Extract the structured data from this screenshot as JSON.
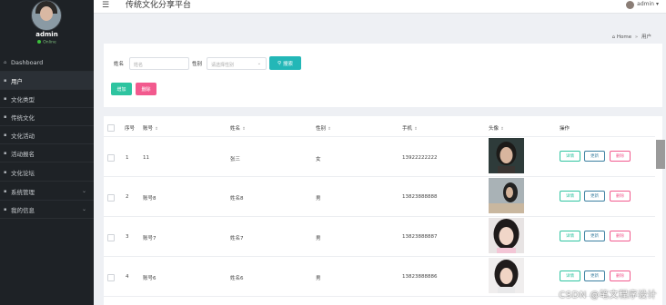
{
  "sidebar": {
    "username": "admin",
    "status": "Online",
    "items": [
      {
        "icon": "home-icon",
        "glyph": "⌂",
        "label": "Dashboard"
      },
      {
        "icon": "grid-icon",
        "glyph": "▪",
        "label": "用户"
      },
      {
        "icon": "grid-icon",
        "glyph": "▪",
        "label": "文化类型"
      },
      {
        "icon": "book-icon",
        "glyph": "▪",
        "label": "传统文化"
      },
      {
        "icon": "list-icon",
        "glyph": "▪",
        "label": "文化活动"
      },
      {
        "icon": "list-icon",
        "glyph": "▪",
        "label": "活动报名"
      },
      {
        "icon": "pin-icon",
        "glyph": "▪",
        "label": "文化论坛"
      },
      {
        "icon": "grid-icon",
        "glyph": "▪",
        "label": "系统管理",
        "chevron": "⌄"
      },
      {
        "icon": "grid-icon",
        "glyph": "▪",
        "label": "我的信息",
        "chevron": "⌄"
      }
    ]
  },
  "header": {
    "title": "传统文化分享平台",
    "user": "admin",
    "user_caret": "▾",
    "menu_glyph": "☰"
  },
  "breadcrumb": {
    "home": "Home",
    "sep": "»",
    "current": "用户",
    "home_glyph": "⌂"
  },
  "search": {
    "name_label": "姓名",
    "name_placeholder": "姓名",
    "gender_label": "性别",
    "gender_placeholder": "请选择性别",
    "gender_caret": "⌄",
    "search_button": "搜索",
    "search_glyph": "⚲"
  },
  "toolbar": {
    "add_label": "增加",
    "delete_label": "删除"
  },
  "table": {
    "headers": {
      "index": "序号",
      "account": "账号",
      "name": "姓名",
      "gender": "性别",
      "phone": "手机",
      "avatar": "头像",
      "actions": "操作"
    },
    "sort_glyph": "⇕",
    "rows": [
      {
        "index": "1",
        "account": "11",
        "name": "张三",
        "gender": "女",
        "phone": "13922222222"
      },
      {
        "index": "2",
        "account": "账号8",
        "name": "姓名8",
        "gender": "男",
        "phone": "13823888888"
      },
      {
        "index": "3",
        "account": "账号7",
        "name": "姓名7",
        "gender": "男",
        "phone": "13823888887"
      },
      {
        "index": "4",
        "account": "账号6",
        "name": "姓名6",
        "gender": "男",
        "phone": "13823888886"
      }
    ],
    "action_labels": {
      "detail": "详情",
      "update": "更新",
      "delete": "删除"
    }
  },
  "watermark": "CSDN @笔文程序设计",
  "colors": {
    "sidebar_bg": "#1e2226",
    "accent_teal": "#23b7b7",
    "add_green": "#2ec4a0",
    "delete_pink": "#f25a8e"
  }
}
